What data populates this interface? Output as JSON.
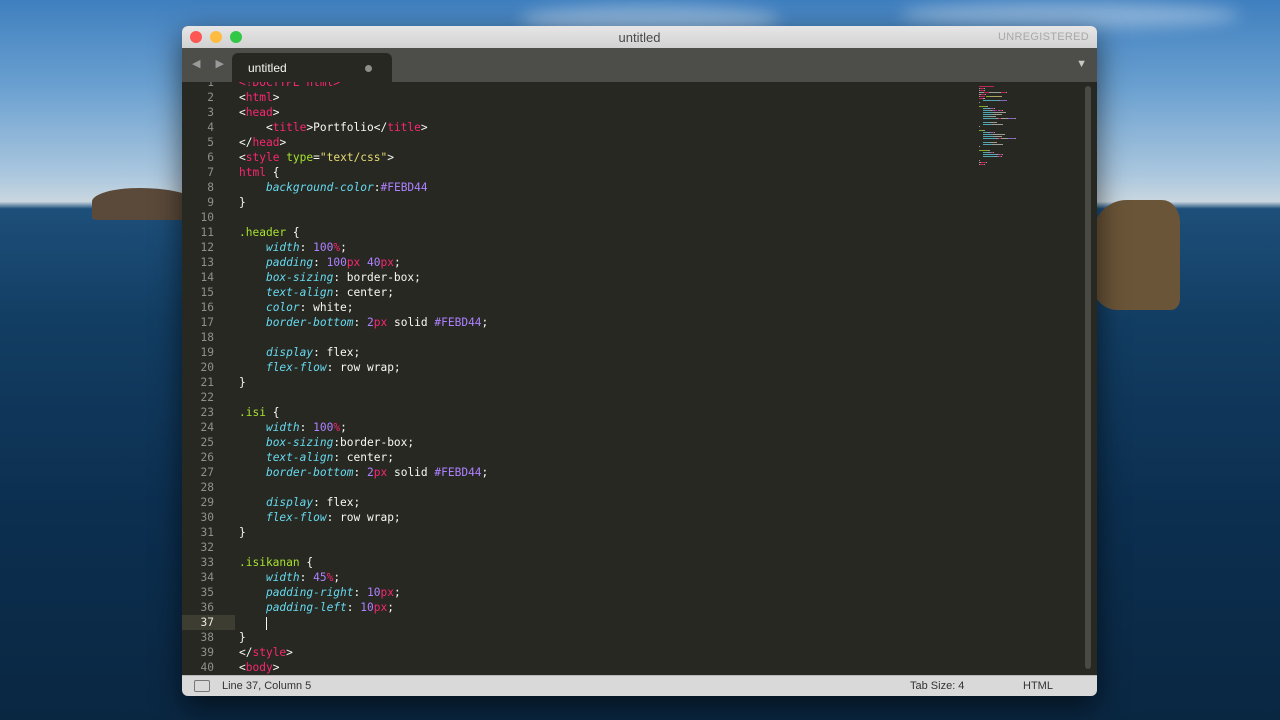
{
  "window": {
    "title": "untitled",
    "registration": "UNREGISTERED"
  },
  "tab": {
    "label": "untitled",
    "nav_arrows": "◀ ▶",
    "dropdown": "▼"
  },
  "status": {
    "position": "Line 37, Column 5",
    "tab_size": "Tab Size: 4",
    "syntax": "HTML"
  },
  "editor": {
    "active_line": 37,
    "lines": [
      [
        [
          "tg",
          "<!DOCTYPE html>"
        ]
      ],
      [
        [
          "wt",
          "<"
        ],
        [
          "tg",
          "html"
        ],
        [
          "wt",
          ">"
        ]
      ],
      [
        [
          "wt",
          "<"
        ],
        [
          "tg",
          "head"
        ],
        [
          "wt",
          ">"
        ]
      ],
      [
        [
          "wt",
          "    <"
        ],
        [
          "tg",
          "title"
        ],
        [
          "wt",
          ">Portfolio</"
        ],
        [
          "tg",
          "title"
        ],
        [
          "wt",
          ">"
        ]
      ],
      [
        [
          "wt",
          "</"
        ],
        [
          "tg",
          "head"
        ],
        [
          "wt",
          ">"
        ]
      ],
      [
        [
          "wt",
          "<"
        ],
        [
          "tg",
          "style"
        ],
        [
          "wt",
          " "
        ],
        [
          "at",
          "type"
        ],
        [
          "wt",
          "="
        ],
        [
          "st",
          "\"text/css\""
        ],
        [
          "wt",
          ">"
        ]
      ],
      [
        [
          "tg",
          "html"
        ],
        [
          "wt",
          " {"
        ]
      ],
      [
        [
          "wt",
          "    "
        ],
        [
          "pr",
          "background-color"
        ],
        [
          "wt",
          ":"
        ],
        [
          "nu",
          "#FEBD44"
        ]
      ],
      [
        [
          "wt",
          "}"
        ]
      ],
      [],
      [
        [
          "cl",
          ".header"
        ],
        [
          "wt",
          " {"
        ]
      ],
      [
        [
          "wt",
          "    "
        ],
        [
          "pr",
          "width"
        ],
        [
          "wt",
          ": "
        ],
        [
          "nu",
          "100"
        ],
        [
          "un",
          "%"
        ],
        [
          "wt",
          ";"
        ]
      ],
      [
        [
          "wt",
          "    "
        ],
        [
          "pr",
          "padding"
        ],
        [
          "wt",
          ": "
        ],
        [
          "nu",
          "100"
        ],
        [
          "un",
          "px"
        ],
        [
          "wt",
          " "
        ],
        [
          "nu",
          "40"
        ],
        [
          "un",
          "px"
        ],
        [
          "wt",
          ";"
        ]
      ],
      [
        [
          "wt",
          "    "
        ],
        [
          "pr",
          "box-sizing"
        ],
        [
          "wt",
          ": border-box;"
        ]
      ],
      [
        [
          "wt",
          "    "
        ],
        [
          "pr",
          "text-align"
        ],
        [
          "wt",
          ": center;"
        ]
      ],
      [
        [
          "wt",
          "    "
        ],
        [
          "pr",
          "color"
        ],
        [
          "wt",
          ": white;"
        ]
      ],
      [
        [
          "wt",
          "    "
        ],
        [
          "pr",
          "border-bottom"
        ],
        [
          "wt",
          ": "
        ],
        [
          "nu",
          "2"
        ],
        [
          "un",
          "px"
        ],
        [
          "wt",
          " solid "
        ],
        [
          "nu",
          "#FEBD44"
        ],
        [
          "wt",
          ";"
        ]
      ],
      [],
      [
        [
          "wt",
          "    "
        ],
        [
          "pr",
          "display"
        ],
        [
          "wt",
          ": flex;"
        ]
      ],
      [
        [
          "wt",
          "    "
        ],
        [
          "pr",
          "flex-flow"
        ],
        [
          "wt",
          ": row wrap;"
        ]
      ],
      [
        [
          "wt",
          "}"
        ]
      ],
      [],
      [
        [
          "cl",
          ".isi"
        ],
        [
          "wt",
          " {"
        ]
      ],
      [
        [
          "wt",
          "    "
        ],
        [
          "pr",
          "width"
        ],
        [
          "wt",
          ": "
        ],
        [
          "nu",
          "100"
        ],
        [
          "un",
          "%"
        ],
        [
          "wt",
          ";"
        ]
      ],
      [
        [
          "wt",
          "    "
        ],
        [
          "pr",
          "box-sizing"
        ],
        [
          "wt",
          ":border-box;"
        ]
      ],
      [
        [
          "wt",
          "    "
        ],
        [
          "pr",
          "text-align"
        ],
        [
          "wt",
          ": center;"
        ]
      ],
      [
        [
          "wt",
          "    "
        ],
        [
          "pr",
          "border-bottom"
        ],
        [
          "wt",
          ": "
        ],
        [
          "nu",
          "2"
        ],
        [
          "un",
          "px"
        ],
        [
          "wt",
          " solid "
        ],
        [
          "nu",
          "#FEBD44"
        ],
        [
          "wt",
          ";"
        ]
      ],
      [],
      [
        [
          "wt",
          "    "
        ],
        [
          "pr",
          "display"
        ],
        [
          "wt",
          ": flex;"
        ]
      ],
      [
        [
          "wt",
          "    "
        ],
        [
          "pr",
          "flex-flow"
        ],
        [
          "wt",
          ": row wrap;"
        ]
      ],
      [
        [
          "wt",
          "}"
        ]
      ],
      [],
      [
        [
          "cl",
          ".isikanan"
        ],
        [
          "wt",
          " {"
        ]
      ],
      [
        [
          "wt",
          "    "
        ],
        [
          "pr",
          "width"
        ],
        [
          "wt",
          ": "
        ],
        [
          "nu",
          "45"
        ],
        [
          "un",
          "%"
        ],
        [
          "wt",
          ";"
        ]
      ],
      [
        [
          "wt",
          "    "
        ],
        [
          "pr",
          "padding-right"
        ],
        [
          "wt",
          ": "
        ],
        [
          "nu",
          "10"
        ],
        [
          "un",
          "px"
        ],
        [
          "wt",
          ";"
        ]
      ],
      [
        [
          "wt",
          "    "
        ],
        [
          "pr",
          "padding-left"
        ],
        [
          "wt",
          ": "
        ],
        [
          "nu",
          "10"
        ],
        [
          "un",
          "px"
        ],
        [
          "wt",
          ";"
        ]
      ],
      [
        [
          "wt",
          "    "
        ]
      ],
      [
        [
          "wt",
          "}"
        ]
      ],
      [
        [
          "wt",
          "</"
        ],
        [
          "tg",
          "style"
        ],
        [
          "wt",
          ">"
        ]
      ],
      [
        [
          "wt",
          "<"
        ],
        [
          "tg",
          "body"
        ],
        [
          "wt",
          ">"
        ]
      ]
    ]
  }
}
